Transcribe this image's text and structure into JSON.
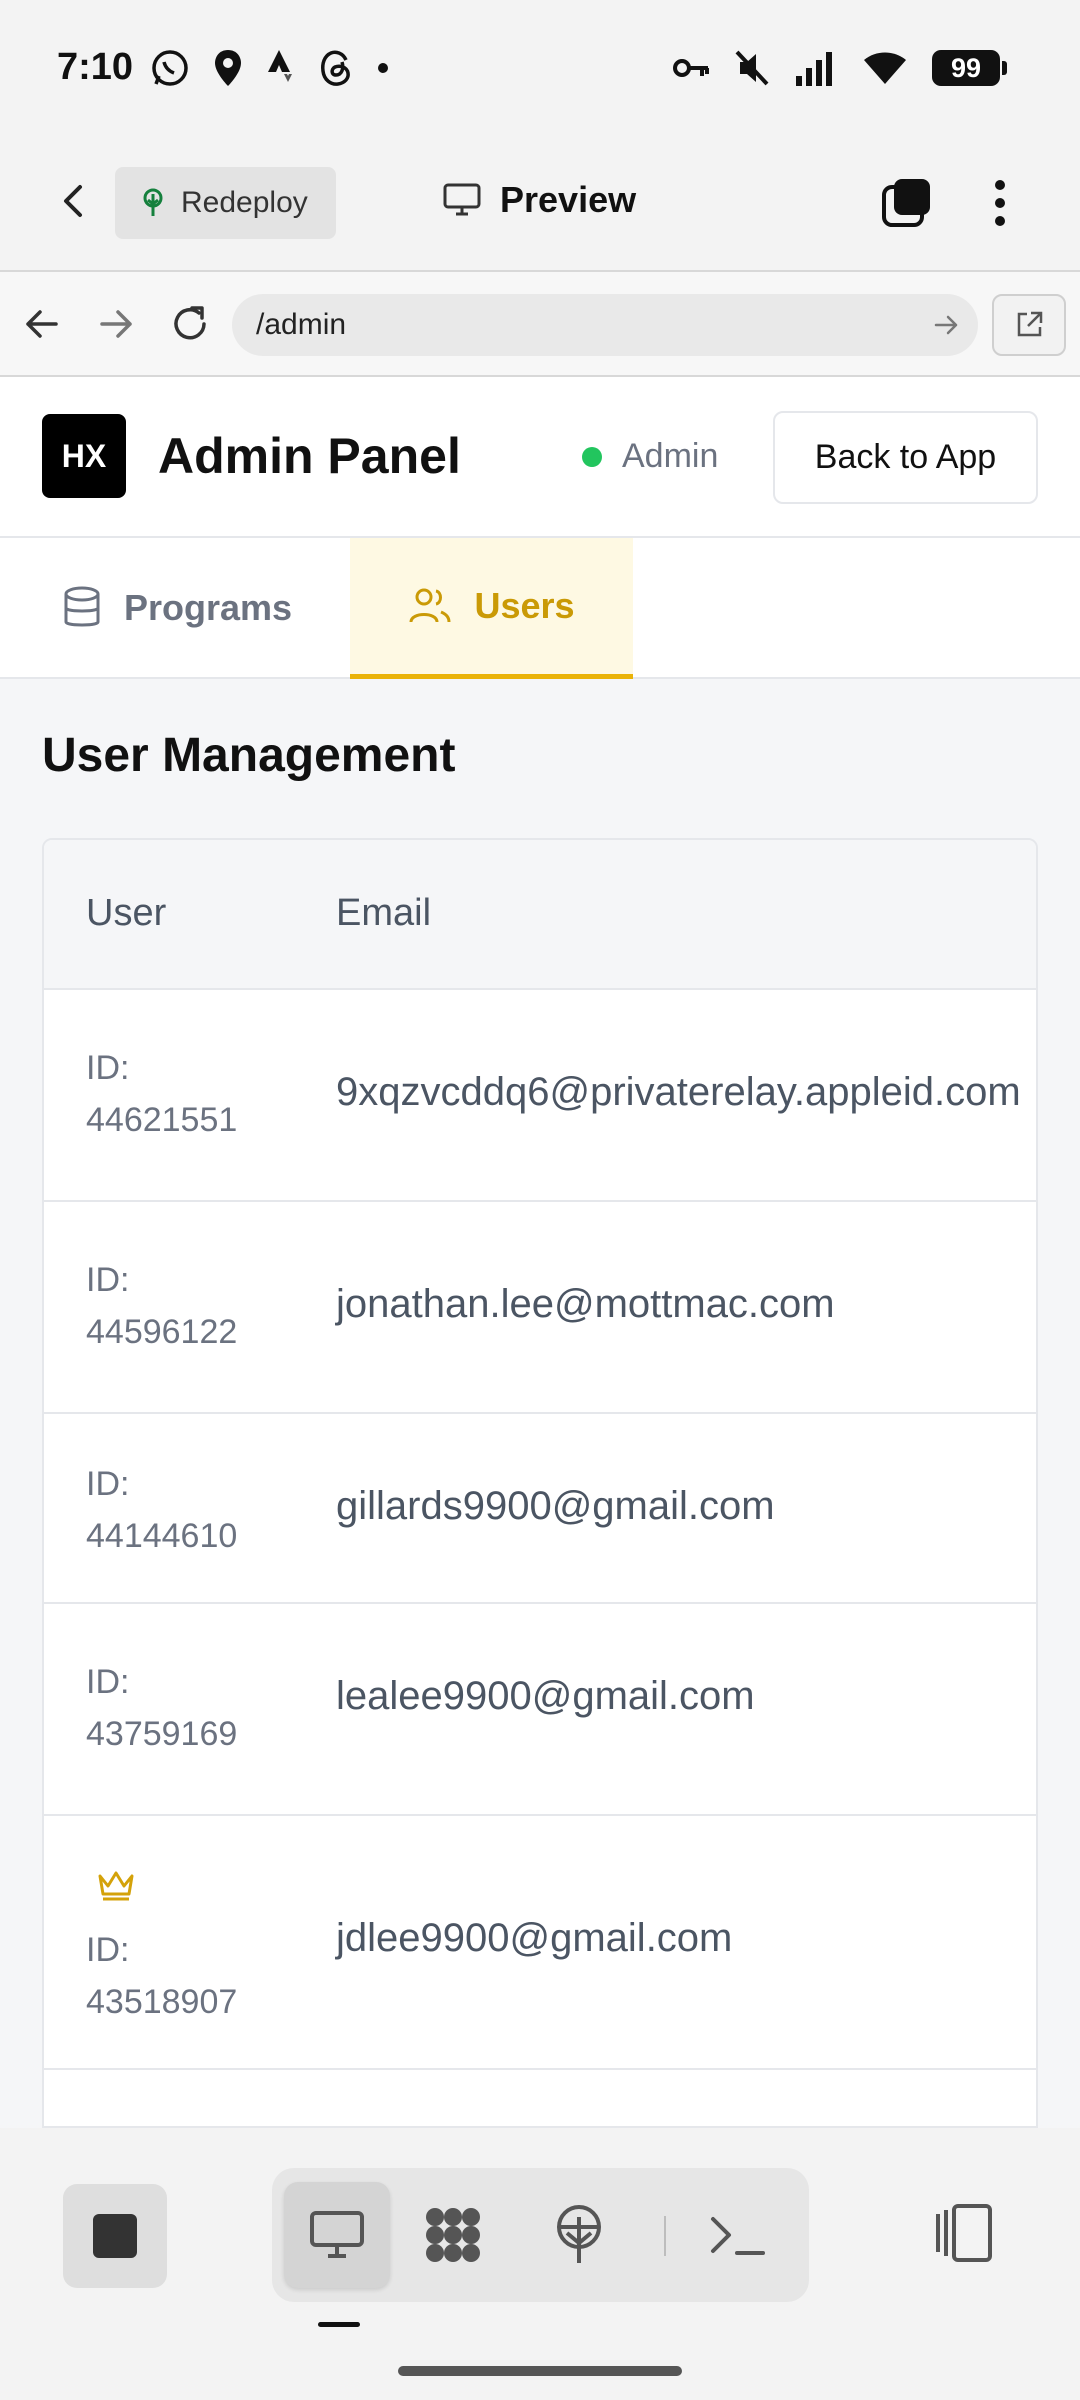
{
  "status_bar": {
    "time": "7:10",
    "battery": "99"
  },
  "toolbar": {
    "redeploy_label": "Redeploy",
    "preview_label": "Preview"
  },
  "browser": {
    "url": "/admin"
  },
  "admin": {
    "logo_text": "HX",
    "title": "Admin Panel",
    "role": "Admin",
    "back_button": "Back to App"
  },
  "tabs": [
    {
      "label": "Programs",
      "active": false
    },
    {
      "label": "Users",
      "active": true
    }
  ],
  "section_title": "User Management",
  "table": {
    "headers": [
      "User",
      "Email"
    ],
    "rows": [
      {
        "id_label": "ID:",
        "id": "44621551",
        "email": "9xqzvcddq6@privaterelay.appleid.com",
        "crown": false
      },
      {
        "id_label": "ID:",
        "id": "44596122",
        "email": "jonathan.lee@mottmac.com",
        "crown": false
      },
      {
        "id_label": "ID:",
        "id": "44144610",
        "email": "gillards9900@gmail.com",
        "crown": false
      },
      {
        "id_label": "ID:",
        "id": "43759169",
        "email": "lealee9900@gmail.com",
        "crown": false
      },
      {
        "id_label": "ID:",
        "id": "43518907",
        "email": "jdlee9900@gmail.com",
        "crown": true
      }
    ]
  },
  "colors": {
    "accent": "#eab308",
    "accent_text": "#ca9a06",
    "status_green": "#22c55e"
  }
}
